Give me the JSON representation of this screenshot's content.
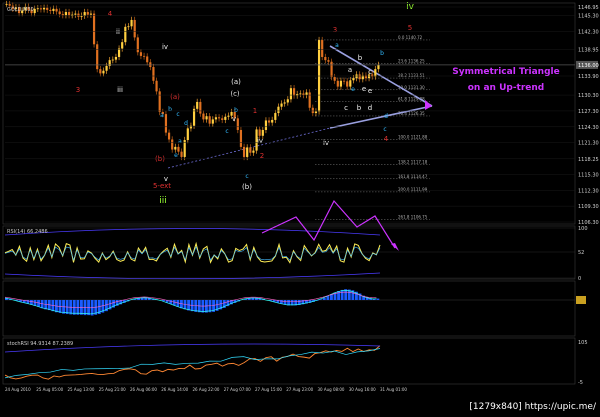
{
  "chart_data": {
    "type": "line",
    "symbol_label": "GOLD,M30",
    "annotation": [
      "Symmetrical Triangle",
      "on an Up-trend"
    ],
    "price_axis": [
      "1146.95",
      "1145.30",
      "1142.30",
      "1138.95",
      "1136.00",
      "1133.90",
      "1130.30",
      "1127.30",
      "1124.30",
      "1121.30",
      "1118.25",
      "1115.30",
      "1112.30",
      "1109.30",
      "1106.30"
    ],
    "current_price": "1136.00",
    "fib_labels": [
      "0.0 1140.72",
      "23.6 1136.25",
      "38.2 1133.51",
      "50.0 1131.30",
      "61.8 1129.08",
      "76.4 1126.35",
      "100.0 1121.88",
      "138.2 1117.18",
      "161.8 1114.47",
      "200.0 1111.99",
      "261.8 1106.75"
    ],
    "wave_labels": {
      "red": [
        "4",
        "3",
        "(a)",
        "1",
        "2",
        "(b)",
        "3",
        "4",
        "5",
        "5-ext"
      ],
      "white": [
        "(a)",
        "(c)",
        "(b)",
        "iv",
        "v",
        "ii",
        "iii",
        "iv",
        "v",
        "b",
        "a",
        "c",
        "e",
        "d",
        "e",
        "c",
        "b",
        "iv"
      ],
      "cyan": [
        "a",
        "b",
        "c",
        "d",
        "e",
        "a",
        "b",
        "c",
        "e",
        "c",
        "a",
        "d",
        "b",
        "c"
      ],
      "green": [
        "iii",
        "iv"
      ]
    },
    "rsi_label": "RSI(14) 66.2486",
    "rsi_axis": [
      "100",
      "52",
      "0"
    ],
    "macd_axis": [
      "0"
    ],
    "stochrsi_label": "stochRSI 94.9314 87.2389",
    "stochrsi_axis": [
      "105",
      "-5"
    ],
    "time_axis": [
      "24 Aug 2010",
      "25 Aug 05:00",
      "25 Aug 13:00",
      "25 Aug 21:00",
      "26 Aug 06:00",
      "26 Aug 14:00",
      "26 Aug 22:00",
      "27 Aug 07:00",
      "27 Aug 15:00",
      "27 Aug 23:00",
      "30 Aug 08:00",
      "30 Aug 16:00",
      "31 Aug 01:00"
    ],
    "watermark": "[1279x840] https://upic.me/",
    "series": {
      "price_close": [
        1147.5,
        1147.2,
        1146.6,
        1146.9,
        1145.8,
        1146.3,
        1147.0,
        1146.4,
        1145.8,
        1146.6,
        1146.7,
        1146.5,
        1146.8,
        1146.4,
        1146.2,
        1146.6,
        1146.1,
        1145.6,
        1145.4,
        1146.0,
        1145.4,
        1145.5,
        1145.7,
        1145.1,
        1145.3,
        1146.0,
        1145.5,
        1145.7,
        1139.9,
        1135.2,
        1134.4,
        1134.9,
        1135.8,
        1136.9,
        1137.0,
        1137.5,
        1139.1,
        1140.3,
        1143.2,
        1143.3,
        1144.5,
        1141.2,
        1138.4,
        1137.7,
        1137.6,
        1136.5,
        1135.6,
        1133.0,
        1131.0,
        1127.1,
        1126.7,
        1123.2,
        1121.9,
        1120.0,
        1120.5,
        1119.6,
        1118.6,
        1121.8,
        1124.0,
        1124.5,
        1127.7,
        1129.0,
        1126.8,
        1125.7,
        1126.3,
        1124.9,
        1125.7,
        1126.1,
        1125.9,
        1125.6,
        1126.2,
        1126.4,
        1127.1,
        1125.9,
        1123.7,
        1120.5,
        1118.6,
        1120.4,
        1119.4,
        1119.8,
        1123.8,
        1122.6,
        1123.7,
        1125.5,
        1125.1,
        1125.6,
        1126.9,
        1128.1,
        1128.7,
        1128.9,
        1129.5,
        1131.6,
        1130.2,
        1130.5,
        1130.6,
        1130.3,
        1130.8,
        1127.9,
        1126.9,
        1127.2,
        1140.7,
        1137.5,
        1136.9,
        1136.6,
        1133.7,
        1133.0,
        1131.9,
        1133.0,
        1132.9,
        1131.9,
        1133.1,
        1133.5,
        1134.2,
        1133.3,
        1134.0,
        1133.5,
        1134.2,
        1133.8,
        1135.2,
        1136.0
      ],
      "rsi": [
        50.3,
        53.4,
        57.0,
        45.7,
        63.4,
        39.9,
        33.6,
        60.4,
        36.7,
        57.8,
        34.4,
        45.9,
        65.6,
        40.9,
        68.2,
        61.3,
        43.9,
        68.6,
        66.0,
        31.2,
        60.3,
        37.9,
        38.4,
        54.2,
        49.7,
        39.2,
        31.7,
        49.8,
        36.8,
        42.3,
        53.7,
        37.1,
        33.4,
        35.8,
        52.4,
        37.7,
        34.1,
        59.9,
        49.3,
        61.2,
        37.0,
        37.6,
        34.0,
        46.8,
        54.2,
        59.5,
        41.4,
        67.5,
        48.2,
        55.2,
        32.3,
        66.9,
        45.6,
        68.8,
        39.7,
        58.1,
        63.4,
        31.3,
        46.0,
        38.2,
        58.4,
        48.1,
        31.9,
        34.8,
        59.2,
        55.0,
        57.8,
        67.1,
        36.2,
        61.3,
        42.1,
        33.4,
        31.9,
        32.9,
        34.1,
        43.9,
        67.1,
        40.1,
        41.6,
        30.8,
        54.6,
        42.3,
        34.9,
        64.9,
        54.0,
        44.2,
        50.5,
        67.4,
        53.3,
        55.2,
        66.6,
        50.6,
        63.9,
        34.4,
        31.8,
        59.5,
        42.1,
        68.2,
        65.2,
        48.8,
        39.3,
        34.8,
        50.1,
        46.5,
        66.2
      ],
      "macd": [
        0.6,
        0.4,
        0.1,
        -0.2,
        -0.5,
        -0.8,
        -1.0,
        -1.3,
        -1.6,
        -1.9,
        -2.3,
        -2.6,
        -2.8,
        -3.1,
        -3.4,
        -3.6,
        -3.8,
        -3.9,
        -4.0,
        -4.1,
        -4.1,
        -4.1,
        -4.2,
        -4.2,
        -4.3,
        -4.1,
        -3.9,
        -3.5,
        -3.1,
        -2.6,
        -2.1,
        -1.6,
        -1.2,
        -0.8,
        -0.4,
        0.0,
        0.3,
        0.5,
        0.6,
        0.7,
        0.6,
        0.4,
        0.2,
        0.0,
        -0.3,
        -0.7,
        -1.1,
        -1.5,
        -1.9,
        -2.3,
        -2.6,
        -2.9,
        -3.1,
        -3.3,
        -3.4,
        -3.5,
        -3.5,
        -3.4,
        -3.3,
        -3.0,
        -2.6,
        -2.2,
        -1.7,
        -1.2,
        -0.8,
        -0.4,
        0.0,
        0.3,
        0.5,
        0.6,
        0.6,
        0.5,
        0.3,
        0.0,
        -0.2,
        -0.5,
        -0.8,
        -1.1,
        -1.3,
        -1.5,
        -1.5,
        -1.5,
        -1.4,
        -1.2,
        -1.0,
        -0.8,
        -0.5,
        -0.2,
        0.2,
        0.6,
        1.1,
        1.6,
        2.1,
        2.5,
        2.8,
        3.0,
        2.9,
        2.7,
        2.3,
        1.8,
        1.2,
        0.8,
        0.5,
        0.3,
        0.4
      ],
      "stochrsi": [
        14.1,
        6.6,
        3.5,
        6.1,
        11.0,
        13.6,
        14.2,
        6.0,
        2.8,
        11.6,
        8.9,
        13.4,
        14.2,
        14.8,
        15.9,
        17.4,
        18.6,
        16.0,
        15.4,
        17.8,
        18.6,
        26.2,
        29.9,
        31.3,
        28.6,
        18.0,
        16.6,
        26.1,
        28.0,
        23.3,
        29.7,
        28.0,
        32.4,
        31.7,
        41.5,
        30.8,
        32.1,
        41.6,
        43.6,
        46.9,
        38.6,
        45.0,
        46.2,
        40.7,
        48.3,
        58.5,
        59.4,
        51.7,
        61.9,
        64.5,
        52.4,
        62.8,
        65.4,
        71.6,
        64.9,
        63.4,
        60.7,
        73.1,
        75.6,
        80.6,
        77.3,
        81.7,
        79.2,
        87.9,
        78.6,
        85.7,
        78.7,
        83.3,
        82.3,
        94.9
      ],
      "stochrsi_signal": [
        6.3,
        13.3,
        15.9,
        20.6,
        22.3,
        29.5,
        26.9,
        30.9,
        31.5,
        31.8,
        32.1,
        33.6,
        44.0,
        43.4,
        47.5,
        43.5,
        46.4,
        47.0,
        52.4,
        52.2,
        62.7,
        64.8,
        56.6,
        58.8,
        58.5,
        66.8,
        70.4,
        77.1,
        74.6,
        80.3,
        70.5,
        77.8,
        80.6,
        87.2
      ]
    }
  }
}
